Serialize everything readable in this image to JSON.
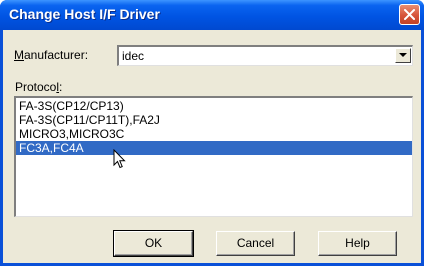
{
  "dialog": {
    "title": "Change Host I/F Driver"
  },
  "manufacturer": {
    "label_prefix": "",
    "label_key": "M",
    "label_rest": "anufacturer:",
    "value": "idec"
  },
  "protocol": {
    "label_prefix": "Protoco",
    "label_key": "l",
    "label_rest": ":",
    "items": [
      "FA-3S(CP12/CP13)",
      "FA-3S(CP11/CP11T),FA2J",
      "MICRO3,MICRO3C",
      "FC3A,FC4A"
    ],
    "selected_index": 3
  },
  "buttons": {
    "ok": "OK",
    "cancel": "Cancel",
    "help": "Help"
  }
}
